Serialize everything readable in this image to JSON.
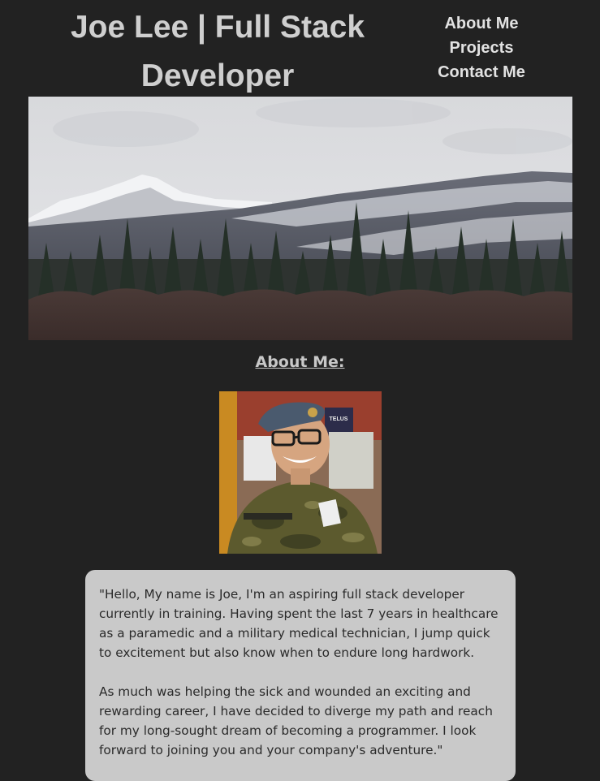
{
  "header": {
    "title": "Joe Lee | Full Stack Developer"
  },
  "nav": {
    "items": [
      {
        "label": "About Me"
      },
      {
        "label": "Projects"
      },
      {
        "label": "Contact Me"
      }
    ]
  },
  "about": {
    "heading": "About Me:",
    "paragraphs": [
      "\"Hello, My name is Joe, I'm an aspiring full stack developer currently in training. Having spent the last 7 years in healthcare as a paramedic and a military medical technician, I jump quick to excitement but also know when to endure long hardwork.",
      "As much was helping the sick and wounded an exciting and rewarding career, I have decided to diverge my path and reach for my long-sought dream of becoming a programmer. I look forward to joining you and your company's adventure.\""
    ]
  },
  "portrait": {
    "badge_text": "TELUS"
  },
  "colors": {
    "page_background": "#222222",
    "card_background": "#c9c9c9",
    "title_text": "#cfcfcf"
  }
}
